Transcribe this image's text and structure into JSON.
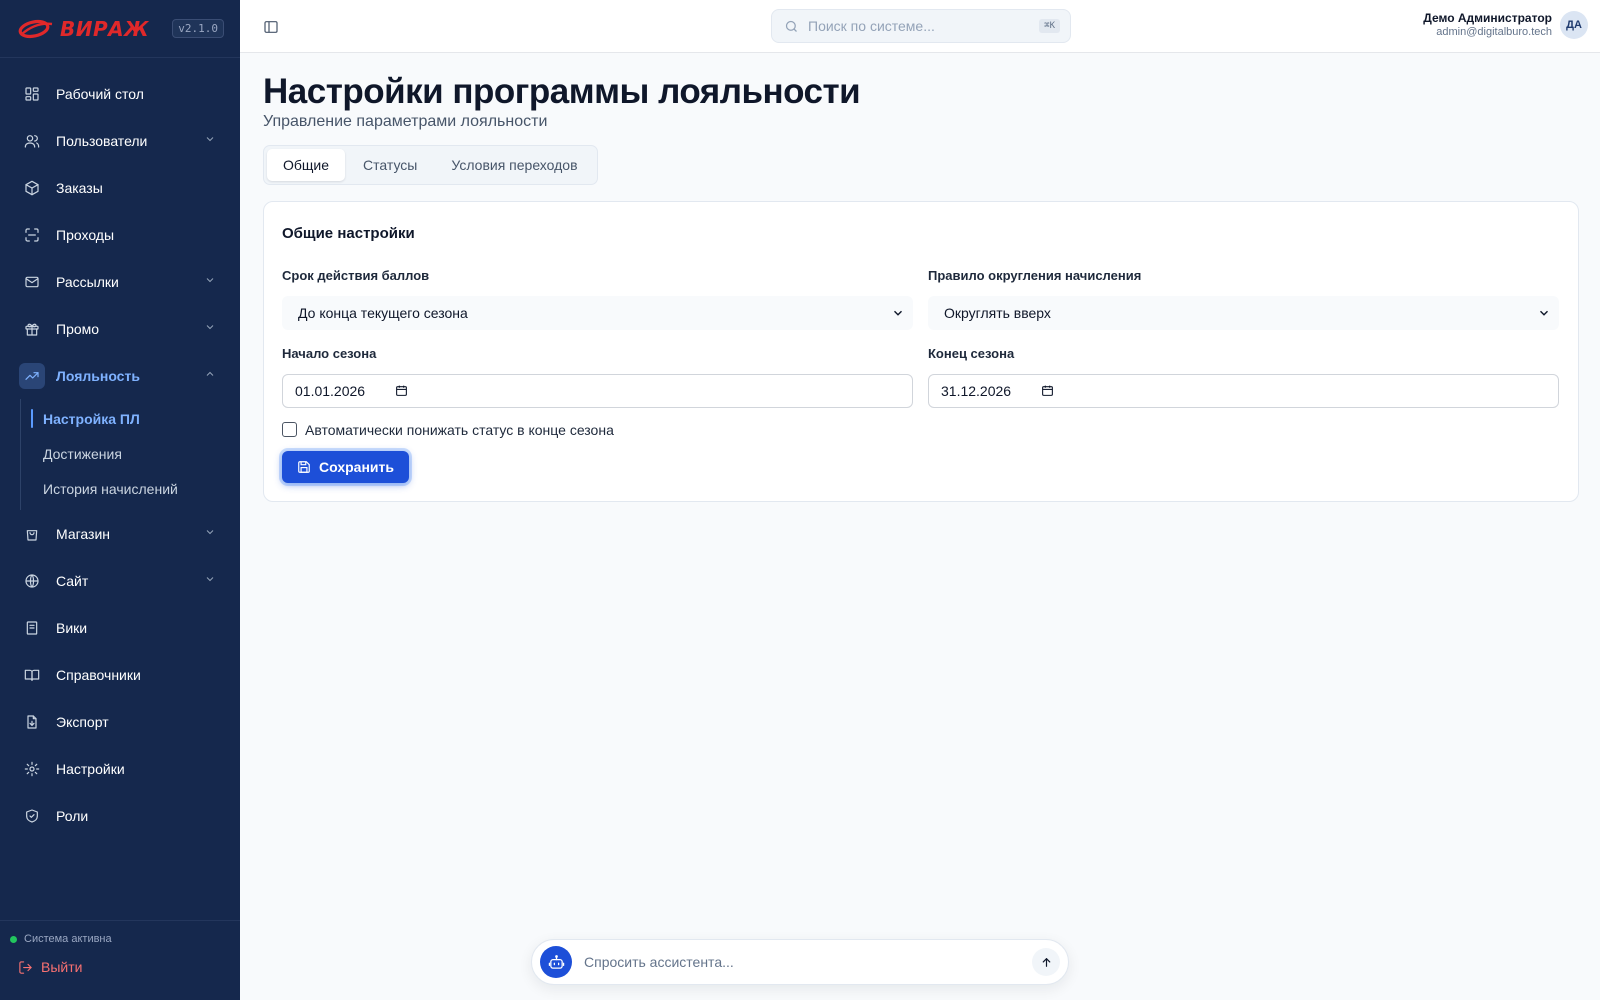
{
  "brand": {
    "logo_text": "ВИРАЖ",
    "version": "v2.1.0",
    "accent_color": "#e0282a"
  },
  "sidebar": {
    "items": [
      {
        "label": "Рабочий стол",
        "icon": "dashboard-icon"
      },
      {
        "label": "Пользователи",
        "icon": "users-icon",
        "expandable": true
      },
      {
        "label": "Заказы",
        "icon": "package-icon"
      },
      {
        "label": "Проходы",
        "icon": "scan-icon"
      },
      {
        "label": "Рассылки",
        "icon": "mail-icon",
        "expandable": true
      },
      {
        "label": "Промо",
        "icon": "gift-icon",
        "expandable": true
      },
      {
        "label": "Лояльность",
        "icon": "trending-up-icon",
        "expandable": true,
        "expanded": true,
        "active": true
      },
      {
        "label": "Магазин",
        "icon": "shopping-bag-icon",
        "expandable": true
      },
      {
        "label": "Сайт",
        "icon": "globe-icon",
        "expandable": true
      },
      {
        "label": "Вики",
        "icon": "book-icon"
      },
      {
        "label": "Справочники",
        "icon": "book-open-icon"
      },
      {
        "label": "Экспорт",
        "icon": "file-export-icon"
      },
      {
        "label": "Настройки",
        "icon": "gear-icon"
      },
      {
        "label": "Роли",
        "icon": "shield-icon"
      }
    ],
    "loyalty_sub": [
      {
        "label": "Настройка ПЛ",
        "active": true
      },
      {
        "label": "Достижения"
      },
      {
        "label": "История начислений"
      }
    ],
    "status_text": "Система активна",
    "logout_label": "Выйти"
  },
  "header": {
    "search_placeholder": "Поиск по системе...",
    "search_shortcut": "⌘K",
    "user_name": "Демо Администратор",
    "user_email": "admin@digitalburo.tech",
    "user_initials": "ДА"
  },
  "page": {
    "title": "Настройки программы лояльности",
    "subtitle": "Управление параметрами лояльности",
    "tabs": [
      {
        "label": "Общие",
        "active": true
      },
      {
        "label": "Статусы"
      },
      {
        "label": "Условия переходов"
      }
    ]
  },
  "card": {
    "title": "Общие настройки",
    "expiry_label": "Срок действия баллов",
    "expiry_value": "До конца текущего сезона",
    "rounding_label": "Правило округления начисления",
    "rounding_value": "Округлять вверх",
    "season_start_label": "Начало сезона",
    "season_start_value": "01.01.2026",
    "season_end_label": "Конец сезона",
    "season_end_value": "31.12.2026",
    "auto_downgrade_label": "Автоматически понижать статус в конце сезона",
    "auto_downgrade_checked": false,
    "save_label": "Сохранить"
  },
  "assistant": {
    "placeholder": "Спросить ассистента..."
  },
  "colors": {
    "sidebar_bg": "#15284d",
    "primary": "#1d4fd8",
    "active_nav": "#7fb2ff",
    "logout": "#f87171",
    "status_ok": "#22c55e"
  }
}
